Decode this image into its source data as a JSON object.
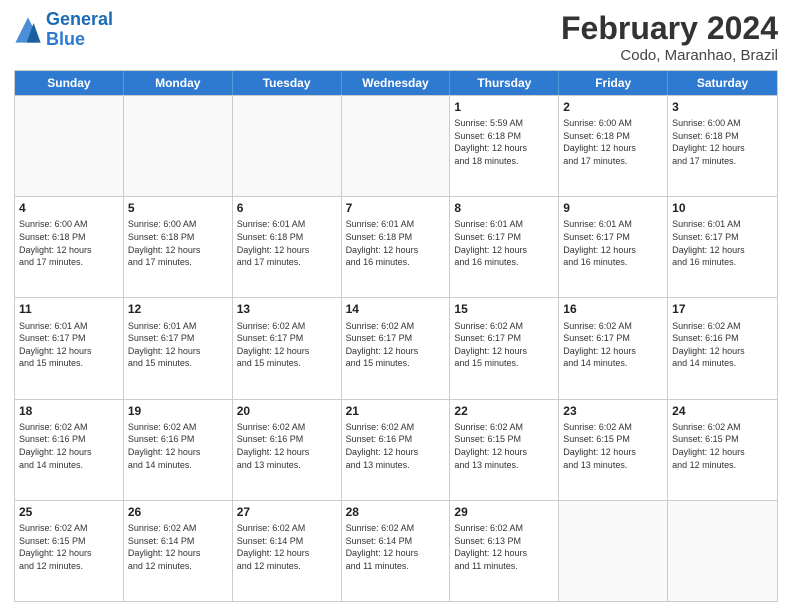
{
  "header": {
    "logo_line1": "General",
    "logo_line2": "Blue",
    "title": "February 2024",
    "location": "Codo, Maranhao, Brazil"
  },
  "weekdays": [
    "Sunday",
    "Monday",
    "Tuesday",
    "Wednesday",
    "Thursday",
    "Friday",
    "Saturday"
  ],
  "rows": [
    [
      {
        "day": "",
        "info": ""
      },
      {
        "day": "",
        "info": ""
      },
      {
        "day": "",
        "info": ""
      },
      {
        "day": "",
        "info": ""
      },
      {
        "day": "1",
        "info": "Sunrise: 5:59 AM\nSunset: 6:18 PM\nDaylight: 12 hours\nand 18 minutes."
      },
      {
        "day": "2",
        "info": "Sunrise: 6:00 AM\nSunset: 6:18 PM\nDaylight: 12 hours\nand 17 minutes."
      },
      {
        "day": "3",
        "info": "Sunrise: 6:00 AM\nSunset: 6:18 PM\nDaylight: 12 hours\nand 17 minutes."
      }
    ],
    [
      {
        "day": "4",
        "info": "Sunrise: 6:00 AM\nSunset: 6:18 PM\nDaylight: 12 hours\nand 17 minutes."
      },
      {
        "day": "5",
        "info": "Sunrise: 6:00 AM\nSunset: 6:18 PM\nDaylight: 12 hours\nand 17 minutes."
      },
      {
        "day": "6",
        "info": "Sunrise: 6:01 AM\nSunset: 6:18 PM\nDaylight: 12 hours\nand 17 minutes."
      },
      {
        "day": "7",
        "info": "Sunrise: 6:01 AM\nSunset: 6:18 PM\nDaylight: 12 hours\nand 16 minutes."
      },
      {
        "day": "8",
        "info": "Sunrise: 6:01 AM\nSunset: 6:17 PM\nDaylight: 12 hours\nand 16 minutes."
      },
      {
        "day": "9",
        "info": "Sunrise: 6:01 AM\nSunset: 6:17 PM\nDaylight: 12 hours\nand 16 minutes."
      },
      {
        "day": "10",
        "info": "Sunrise: 6:01 AM\nSunset: 6:17 PM\nDaylight: 12 hours\nand 16 minutes."
      }
    ],
    [
      {
        "day": "11",
        "info": "Sunrise: 6:01 AM\nSunset: 6:17 PM\nDaylight: 12 hours\nand 15 minutes."
      },
      {
        "day": "12",
        "info": "Sunrise: 6:01 AM\nSunset: 6:17 PM\nDaylight: 12 hours\nand 15 minutes."
      },
      {
        "day": "13",
        "info": "Sunrise: 6:02 AM\nSunset: 6:17 PM\nDaylight: 12 hours\nand 15 minutes."
      },
      {
        "day": "14",
        "info": "Sunrise: 6:02 AM\nSunset: 6:17 PM\nDaylight: 12 hours\nand 15 minutes."
      },
      {
        "day": "15",
        "info": "Sunrise: 6:02 AM\nSunset: 6:17 PM\nDaylight: 12 hours\nand 15 minutes."
      },
      {
        "day": "16",
        "info": "Sunrise: 6:02 AM\nSunset: 6:17 PM\nDaylight: 12 hours\nand 14 minutes."
      },
      {
        "day": "17",
        "info": "Sunrise: 6:02 AM\nSunset: 6:16 PM\nDaylight: 12 hours\nand 14 minutes."
      }
    ],
    [
      {
        "day": "18",
        "info": "Sunrise: 6:02 AM\nSunset: 6:16 PM\nDaylight: 12 hours\nand 14 minutes."
      },
      {
        "day": "19",
        "info": "Sunrise: 6:02 AM\nSunset: 6:16 PM\nDaylight: 12 hours\nand 14 minutes."
      },
      {
        "day": "20",
        "info": "Sunrise: 6:02 AM\nSunset: 6:16 PM\nDaylight: 12 hours\nand 13 minutes."
      },
      {
        "day": "21",
        "info": "Sunrise: 6:02 AM\nSunset: 6:16 PM\nDaylight: 12 hours\nand 13 minutes."
      },
      {
        "day": "22",
        "info": "Sunrise: 6:02 AM\nSunset: 6:15 PM\nDaylight: 12 hours\nand 13 minutes."
      },
      {
        "day": "23",
        "info": "Sunrise: 6:02 AM\nSunset: 6:15 PM\nDaylight: 12 hours\nand 13 minutes."
      },
      {
        "day": "24",
        "info": "Sunrise: 6:02 AM\nSunset: 6:15 PM\nDaylight: 12 hours\nand 12 minutes."
      }
    ],
    [
      {
        "day": "25",
        "info": "Sunrise: 6:02 AM\nSunset: 6:15 PM\nDaylight: 12 hours\nand 12 minutes."
      },
      {
        "day": "26",
        "info": "Sunrise: 6:02 AM\nSunset: 6:14 PM\nDaylight: 12 hours\nand 12 minutes."
      },
      {
        "day": "27",
        "info": "Sunrise: 6:02 AM\nSunset: 6:14 PM\nDaylight: 12 hours\nand 12 minutes."
      },
      {
        "day": "28",
        "info": "Sunrise: 6:02 AM\nSunset: 6:14 PM\nDaylight: 12 hours\nand 11 minutes."
      },
      {
        "day": "29",
        "info": "Sunrise: 6:02 AM\nSunset: 6:13 PM\nDaylight: 12 hours\nand 11 minutes."
      },
      {
        "day": "",
        "info": ""
      },
      {
        "day": "",
        "info": ""
      }
    ]
  ]
}
